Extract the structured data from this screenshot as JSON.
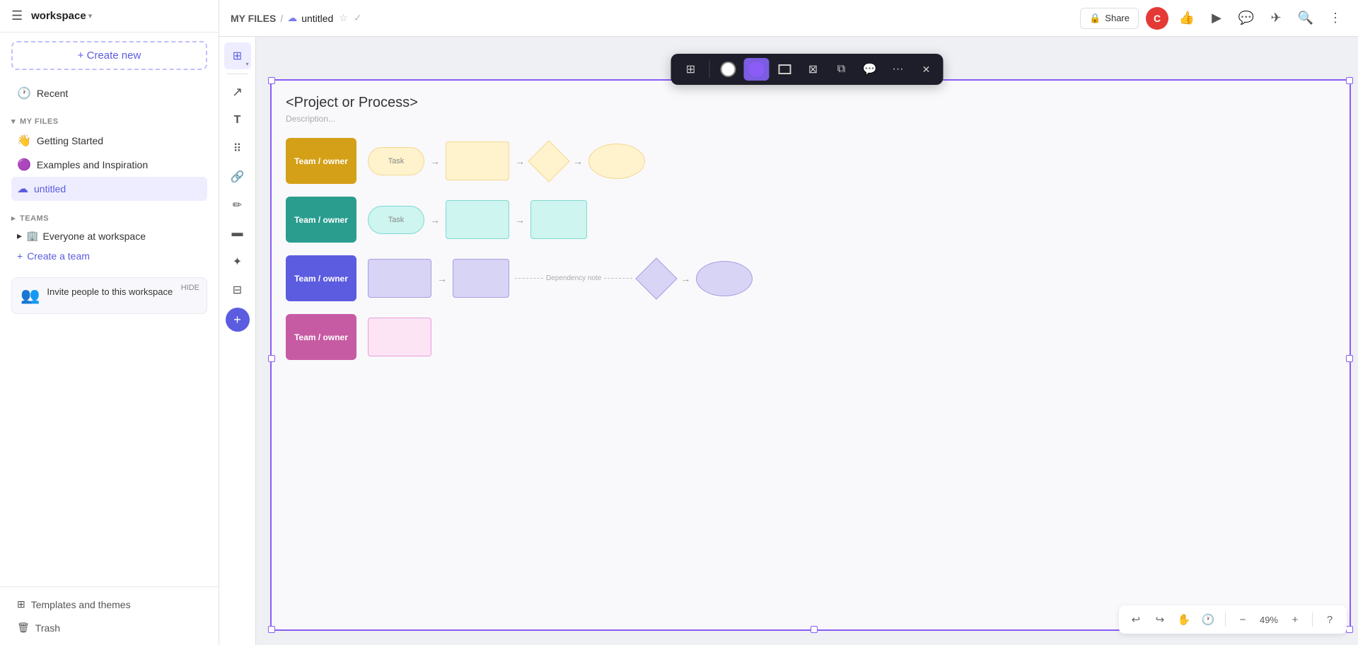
{
  "sidebar": {
    "workspace_name": "workspace",
    "create_new_label": "+ Create new",
    "recent_label": "Recent",
    "my_files_label": "MY FILES",
    "files": [
      {
        "id": "getting-started",
        "icon": "👋",
        "label": "Getting Started"
      },
      {
        "id": "examples",
        "icon": "🟣",
        "label": "Examples and Inspiration"
      },
      {
        "id": "untitled",
        "icon": "☁",
        "label": "untitled",
        "active": true
      }
    ],
    "teams_label": "TEAMS",
    "teams": [
      {
        "id": "everyone",
        "icon": "🏢",
        "label": "Everyone at workspace"
      }
    ],
    "create_team_label": "Create a team",
    "invite_title": "Invite people to this workspace",
    "invite_hide": "HIDE",
    "templates_label": "Templates and themes",
    "trash_label": "Trash"
  },
  "topbar": {
    "my_files": "MY FILES",
    "breadcrumb_sep": "/",
    "file_icon": "☁",
    "file_title": "untitled",
    "share_label": "Share",
    "lock_icon": "🔒"
  },
  "toolbar": {
    "tools": [
      {
        "id": "frame",
        "icon": "⊞",
        "active": false
      },
      {
        "id": "move",
        "icon": "✥",
        "active": false
      },
      {
        "id": "text-tool",
        "icon": "T",
        "active": false
      },
      {
        "id": "grid",
        "icon": "⠿",
        "active": false
      },
      {
        "id": "link",
        "icon": "🔗",
        "active": false
      },
      {
        "id": "pen",
        "icon": "✏",
        "active": false
      },
      {
        "id": "table",
        "icon": "⊟",
        "active": false
      },
      {
        "id": "sparkle",
        "icon": "✦",
        "active": false
      },
      {
        "id": "sections",
        "icon": "⊞",
        "active": false
      }
    ],
    "add_icon": "+"
  },
  "floating_toolbar": {
    "buttons": [
      {
        "id": "ft-grid",
        "icon": "⊞"
      },
      {
        "id": "ft-circle",
        "icon": "○"
      },
      {
        "id": "ft-purple-color",
        "icon": "●",
        "active": true
      },
      {
        "id": "ft-rect",
        "icon": "□"
      },
      {
        "id": "ft-crossed",
        "icon": "⊠"
      },
      {
        "id": "ft-copy",
        "icon": "⧉"
      },
      {
        "id": "ft-chat",
        "icon": "💬"
      },
      {
        "id": "ft-more",
        "icon": "···"
      }
    ],
    "close_icon": "✕"
  },
  "diagram": {
    "title": "<Project or Process>",
    "description": "Description...",
    "swimlanes": [
      {
        "id": "row-yellow",
        "box_label": "Team / owner",
        "box_color": "yellow"
      },
      {
        "id": "row-teal",
        "box_label": "Team / owner",
        "box_color": "teal"
      },
      {
        "id": "row-purple",
        "box_label": "Team / owner",
        "box_color": "blue-purple"
      },
      {
        "id": "row-pink",
        "box_label": "Team / owner",
        "box_color": "magenta"
      }
    ],
    "dependency_note": "Dependency note"
  },
  "bottom_bar": {
    "zoom_level": "49%",
    "undo_icon": "↩",
    "redo_icon": "↪",
    "hand_icon": "✋",
    "history_icon": "🕐",
    "zoom_out_icon": "−",
    "zoom_in_icon": "+",
    "help_icon": "?"
  }
}
